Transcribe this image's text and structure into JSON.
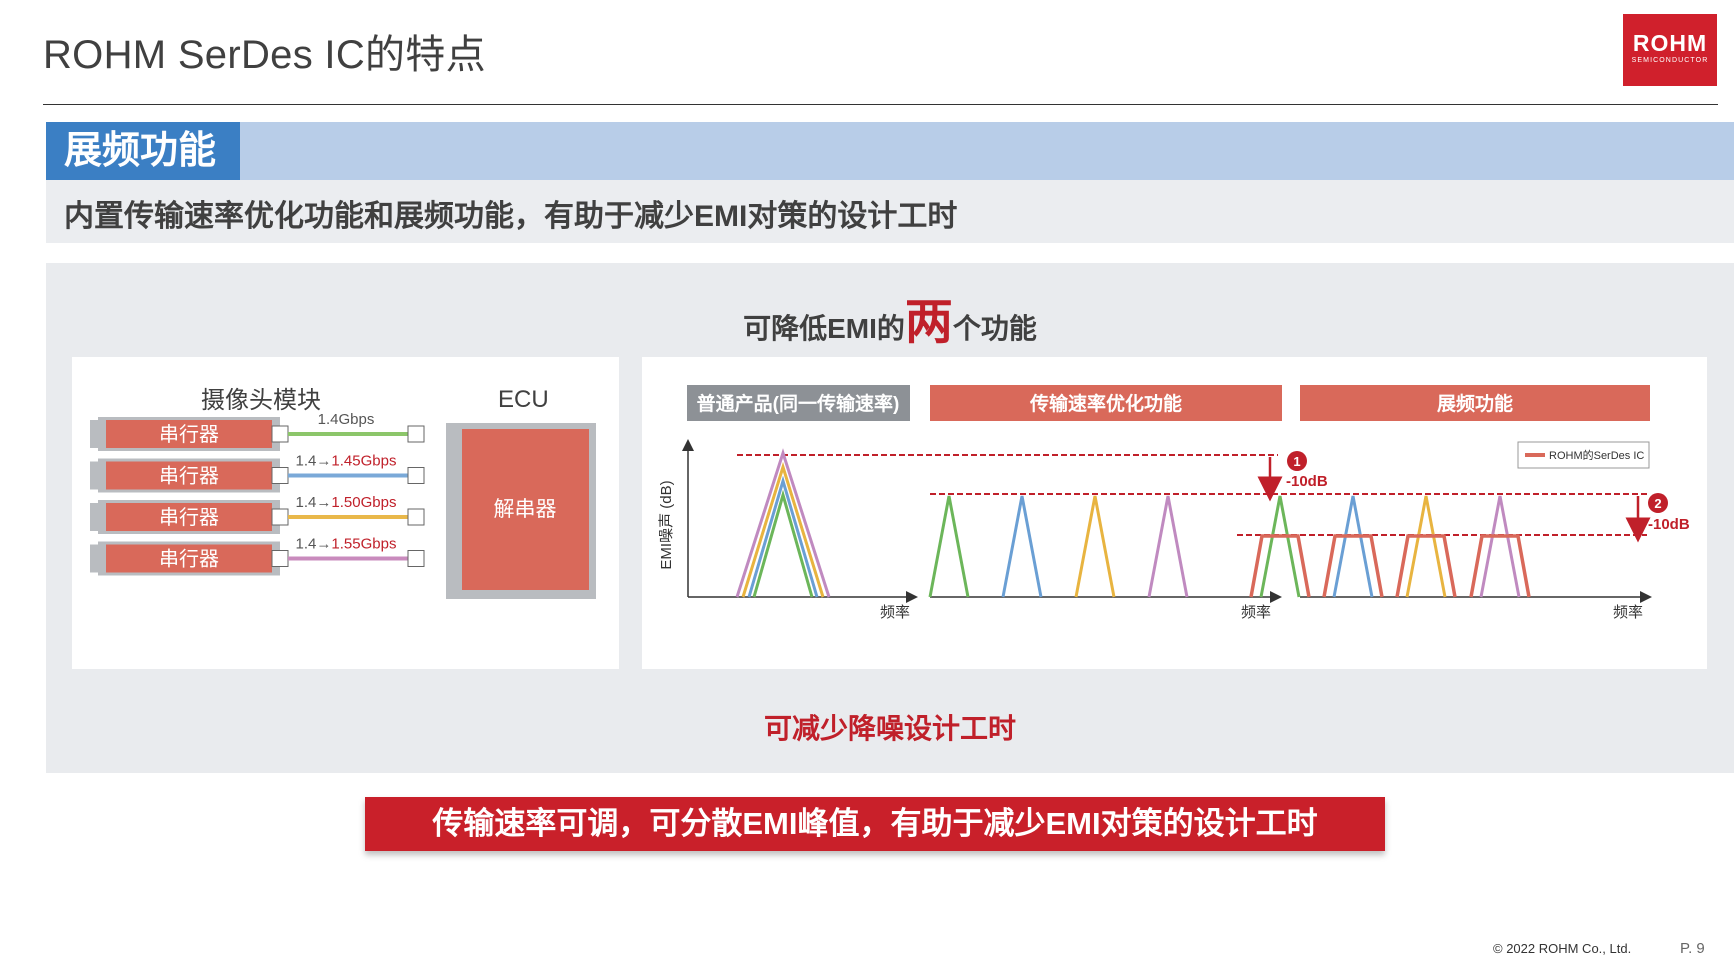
{
  "header": {
    "title": "ROHM SerDes IC的特点",
    "logo_main": "ROHM",
    "logo_sub": "SEMICONDUCTOR"
  },
  "section": {
    "tag": "展频功能",
    "subtitle": "内置传输速率优化功能和展频功能，有助于减少EMI对策的设计工时"
  },
  "panel": {
    "title_pre": "可降低EMI的",
    "title_big": "两",
    "title_post": "个功能",
    "note": "可减少降噪设计工时"
  },
  "block_diagram": {
    "camera_label": "摄像头模块",
    "ecu_label": "ECU",
    "serializer_label": "串行器",
    "deserializer_label": "解串器",
    "links": [
      {
        "prefix": "",
        "value": "1.4Gbps",
        "color": "#8cc66a"
      },
      {
        "prefix": "1.4→",
        "value": "1.45Gbps",
        "color": "#7aa9d8"
      },
      {
        "prefix": "1.4→",
        "value": "1.50Gbps",
        "color": "#e9b84a"
      },
      {
        "prefix": "1.4→",
        "value": "1.55Gbps",
        "color": "#c98bbd"
      }
    ],
    "value_color": "#c0202a"
  },
  "emi_chart": {
    "headers": [
      "普通产品(同一传输速率)",
      "传输速率优化功能",
      "展频功能"
    ],
    "y_label": "EMI噪声 (dB)",
    "x_label": "频率",
    "legend": "ROHM的SerDes IC",
    "steps": [
      {
        "marker": "1",
        "value": "-10dB"
      },
      {
        "marker": "2",
        "value": "-10dB"
      }
    ],
    "colors": {
      "green": "#6cb65a",
      "blue": "#6a9fd4",
      "yellow": "#e8b440",
      "purple": "#c08ac0",
      "rohm": "#d9695a",
      "limit": "#c0202a"
    }
  },
  "conclusion": "传输速率可调，可分散EMI峰值，有助于减少EMI对策的设计工时",
  "footer": {
    "copyright": "© 2022 ROHM Co., Ltd.",
    "page": "P. 9"
  }
}
